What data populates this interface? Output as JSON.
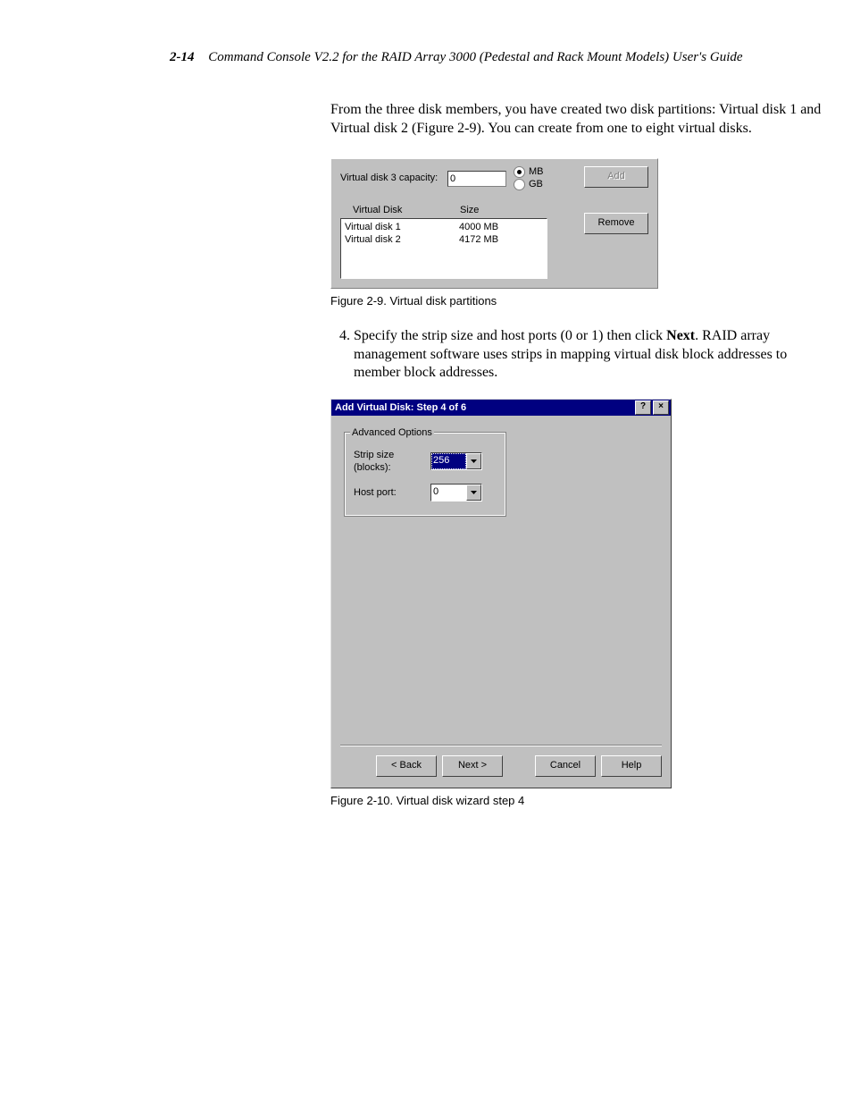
{
  "header": {
    "page_number": "2-14",
    "title": "Command Console V2.2 for the RAID Array 3000 (Pedestal and Rack Mount Models) User's Guide"
  },
  "intro_paragraph": "From the three disk members, you have created two disk partitions: Virtual disk 1 and Virtual disk 2 (Figure 2-9). You can create from one to eight virtual disks.",
  "figure1": {
    "capacity_label": "Virtual disk 3 capacity:",
    "capacity_value": "0",
    "unit_mb": "MB",
    "unit_gb": "GB",
    "unit_selected": "MB",
    "add_button": "Add",
    "remove_button": "Remove",
    "col_disk": "Virtual Disk",
    "col_size": "Size",
    "rows": [
      {
        "name": "Virtual disk 1",
        "size": "4000 MB"
      },
      {
        "name": "Virtual disk 2",
        "size": "4172 MB"
      }
    ],
    "caption": "Figure 2-9.  Virtual disk partitions"
  },
  "step4": {
    "number": "4.",
    "text_before_bold": "Specify the strip size and host ports (0 or 1) then click ",
    "bold": "Next",
    "text_after_bold": ". RAID array management software uses strips in mapping virtual disk block addresses to member block addresses."
  },
  "figure2": {
    "title": "Add Virtual Disk: Step 4 of 6",
    "help_button": "?",
    "close_button": "×",
    "group_label": "Advanced Options",
    "strip_label": "Strip size (blocks):",
    "strip_value": "256",
    "host_label": "Host port:",
    "host_value": "0",
    "buttons": {
      "back": "< Back",
      "next": "Next >",
      "cancel": "Cancel",
      "help": "Help"
    },
    "caption": "Figure 2-10.  Virtual disk wizard step 4"
  }
}
